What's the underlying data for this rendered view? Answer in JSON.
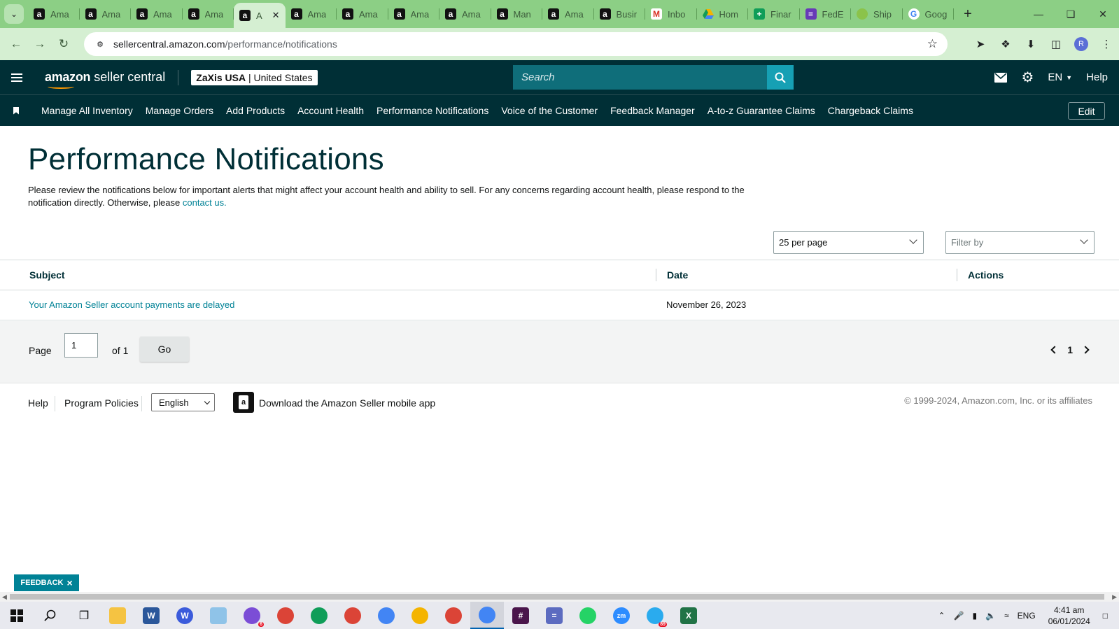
{
  "browser": {
    "tabs": [
      {
        "title": "Ama",
        "icon": "amazon-icon"
      },
      {
        "title": "Ama",
        "icon": "amazon-icon"
      },
      {
        "title": "Ama",
        "icon": "amazon-icon"
      },
      {
        "title": "Ama",
        "icon": "amazon-icon"
      },
      {
        "title": "A",
        "icon": "amazon-icon",
        "active": true
      },
      {
        "title": "Ama",
        "icon": "amazon-icon"
      },
      {
        "title": "Ama",
        "icon": "amazon-icon"
      },
      {
        "title": "Ama",
        "icon": "amazon-icon"
      },
      {
        "title": "Ama",
        "icon": "amazon-icon"
      },
      {
        "title": "Man",
        "icon": "amazon-icon"
      },
      {
        "title": "Ama",
        "icon": "amazon-icon"
      },
      {
        "title": "Busir",
        "icon": "amazon-icon"
      },
      {
        "title": "Inbo",
        "icon": "gmail-icon"
      },
      {
        "title": "Hom",
        "icon": "google-drive-icon"
      },
      {
        "title": "Finar",
        "icon": "google-sheets-icon"
      },
      {
        "title": "FedE",
        "icon": "google-forms-icon"
      },
      {
        "title": "Ship",
        "icon": "shipping-icon"
      },
      {
        "title": "Goog",
        "icon": "google-icon"
      }
    ],
    "url_domain": "sellercentral.amazon.com",
    "url_path": "/performance/notifications",
    "profile_initial": "R",
    "theme_color": "#8ccf85"
  },
  "header": {
    "logo_bold": "amazon",
    "logo_rest": " seller central",
    "account_name": "ZaXis USA",
    "account_region": " | United States",
    "search_placeholder": "Search",
    "language": "EN",
    "help_label": "Help",
    "bg_color": "#002f36"
  },
  "nav": {
    "links": [
      "Manage All Inventory",
      "Manage Orders",
      "Add Products",
      "Account Health",
      "Performance Notifications",
      "Voice of the Customer",
      "Feedback Manager",
      "A-to-z Guarantee Claims",
      "Chargeback Claims"
    ],
    "edit_label": "Edit"
  },
  "main": {
    "title": "Performance Notifications",
    "intro_text": "Please review the notifications below for important alerts that might affect your account health and ability to sell. For any concerns regarding account health, please respond to the notification directly. Otherwise, please ",
    "contact_link": "contact us.",
    "per_page_select": "25 per page",
    "filter_select": "Filter by",
    "table": {
      "columns": [
        "Subject",
        "Date",
        "Actions"
      ],
      "rows": [
        {
          "subject": "Your Amazon Seller account payments are delayed",
          "date": "November 26, 2023",
          "actions": ""
        }
      ]
    },
    "pagination": {
      "page_label": "Page",
      "page_value": "1",
      "of_label": "of 1",
      "go_label": "Go",
      "current_page": "1"
    },
    "link_color": "#008296"
  },
  "footer": {
    "help": "Help",
    "program_policies": "Program Policies",
    "language_select": "English",
    "app_link": "Download the Amazon Seller mobile app",
    "copyright": "© 1999-2024, Amazon.com, Inc. or its affiliates"
  },
  "feedback_tab": {
    "label": "FEEDBACK",
    "close": "×"
  },
  "taskbar": {
    "language": "ENG",
    "time": "4:41 am",
    "date": "06/01/2024",
    "badges": {
      "chrome_profile": "6",
      "telegram": "89"
    }
  }
}
